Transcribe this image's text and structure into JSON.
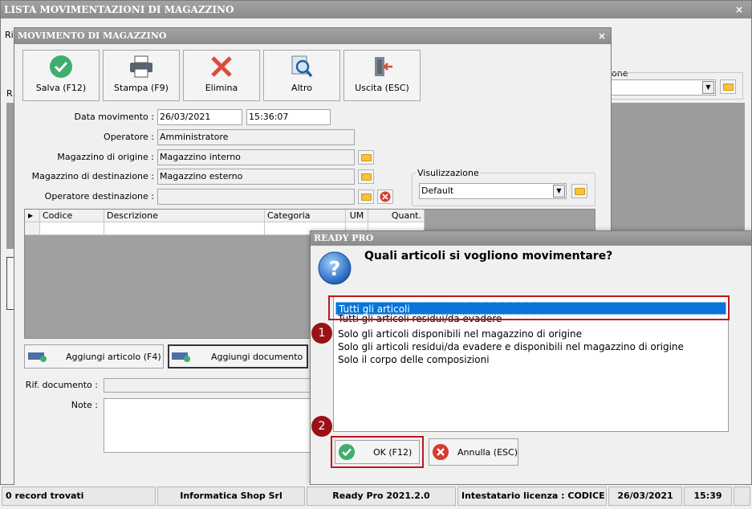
{
  "main_window": {
    "title": "LISTA MOVIMENTAZIONI DI MAGAZZINO",
    "close": "×",
    "partial_label_ri": "Ri",
    "partial_label_r": "R",
    "partial_label_one": "one"
  },
  "dialog": {
    "title": "MOVIMENTO DI MAGAZZINO",
    "close": "×",
    "toolbar": [
      {
        "label": "Salva (F12)",
        "icon": "check-icon"
      },
      {
        "label": "Stampa (F9)",
        "icon": "printer-icon"
      },
      {
        "label": "Elimina",
        "icon": "delete-x-icon"
      },
      {
        "label": "Altro",
        "icon": "magnifier-icon"
      },
      {
        "label": "Uscita (ESC)",
        "icon": "exit-door-icon"
      }
    ],
    "form": {
      "data_label": "Data movimento :",
      "data_value": "26/03/2021",
      "time_value": "15:36:07",
      "operatore_label": "Operatore :",
      "operatore_value": "Amministratore",
      "origine_label": "Magazzino di origine :",
      "origine_value": "Magazzino interno",
      "destinazione_label": "Magazzino di destinazione :",
      "destinazione_value": "Magazzino esterno",
      "op_dest_label": "Operatore destinazione :",
      "op_dest_value": ""
    },
    "visualizzazione": {
      "label": "Visulizzazione",
      "value": "Default"
    },
    "grid_columns": [
      "Codice",
      "Descrizione",
      "Categoria",
      "UM",
      "Quant."
    ],
    "add_article": "Aggiungi articolo (F4)",
    "add_document": "Aggiungi documento",
    "rif_label": "Rif. documento :",
    "note_label": "Note :"
  },
  "ready_pro": {
    "title": "READY PRO",
    "question": "Quali articoli si vogliono movimentare?",
    "options": [
      "Tutti gli articoli",
      "Tutti gli articoli residui/da evadere",
      "Solo gli articoli disponibili nel magazzino di origine",
      "Solo gli articoli residui/da evadere e disponibili nel magazzino di origine",
      "Solo il corpo delle composizioni"
    ],
    "selected_index": 0,
    "ok": "OK (F12)",
    "cancel": "Annulla (ESC)",
    "badge1": "1",
    "badge2": "2"
  },
  "statusbar": {
    "records": "0 record trovati",
    "company": "Informatica Shop Srl",
    "version": "Ready Pro 2021.2.0",
    "license": "Intestatario licenza : CODICE SRL",
    "date": "26/03/2021",
    "time": "15:39"
  },
  "colors": {
    "selection": "#0a74d8",
    "highlight": "#c0161d",
    "titlebar": "#939393"
  }
}
